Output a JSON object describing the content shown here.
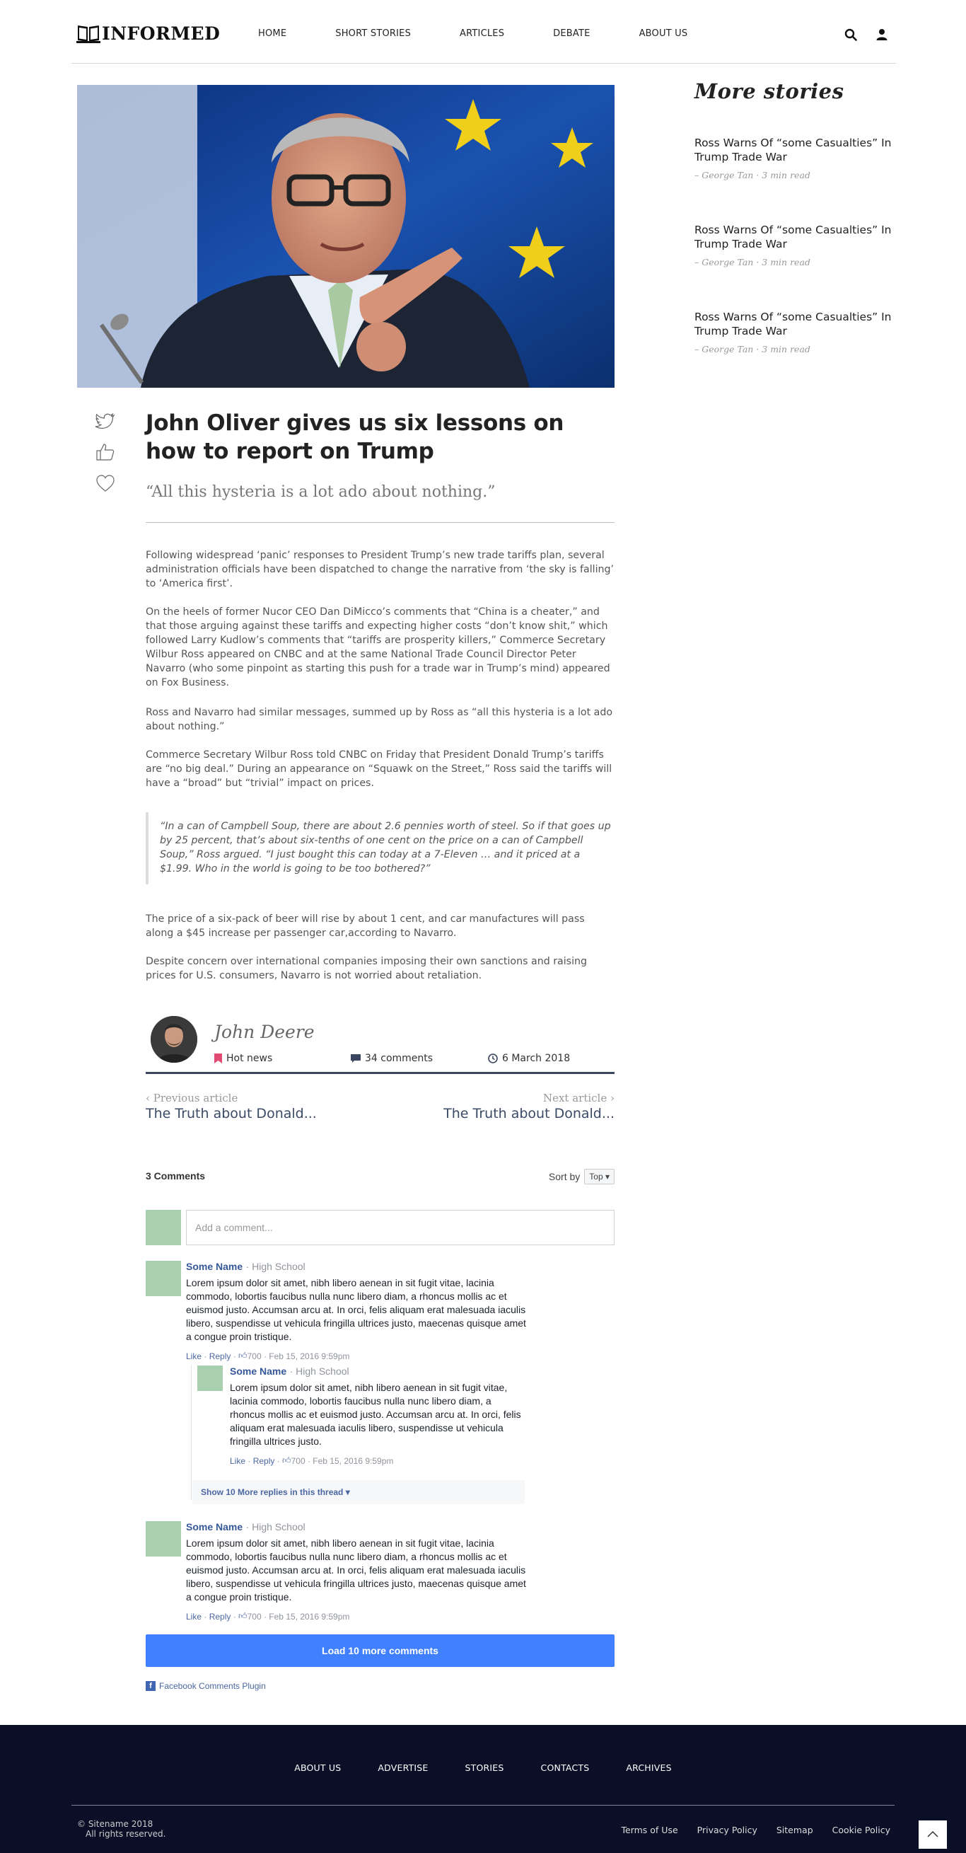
{
  "brand": {
    "name": "INFORMED"
  },
  "nav": {
    "items": [
      "HOME",
      "SHORT STORIES",
      "ARTICLES",
      "DEBATE",
      "ABOUT US"
    ]
  },
  "article": {
    "title": "John Oliver gives us six lessons on how to report on Trump",
    "subtitle": "“All this hysteria is a lot ado about nothing.”",
    "paragraphs": [
      "Following widespread ‘panic’ responses to President Trump’s new trade tariffs plan, several administration officials have been dispatched to change the narrative from ‘the sky is falling’ to ‘America first’.",
      "On the heels of former Nucor CEO Dan DiMicco’s comments that “China is a cheater,” and that those arguing against these tariffs and expecting higher costs “don’t know shit,” which followed Larry Kudlow’s comments that “tariffs are prosperity killers,” Commerce Secretary Wilbur Ross appeared on CNBC and at the same National Trade Council Director Peter Navarro (who some pinpoint as starting this push for a trade war in Trump’s mind) appeared on Fox Business.",
      "Ross and Navarro had similar messages, summed up by Ross as “all this hysteria is a lot ado about nothing.”",
      "Commerce Secretary Wilbur Ross told CNBC on Friday that President Donald Trump’s tariffs are “no big deal.” During an appearance on “Squawk on the Street,” Ross said the tariffs will have a “broad” but “trivial” impact on prices."
    ],
    "quote": "“In a can of Campbell Soup, there are about 2.6 pennies worth of steel. So if that goes up by 25 percent, that’s about six-tenths of one cent on the price on a can of Campbell Soup,” Ross argued. “I just bought this can today at a 7-Eleven … and it priced at a $1.99. Who in the world is going to be too bothered?”",
    "paragraphs_after": [
      "The price of a six-pack of beer will rise by about 1 cent, and car manufactures will pass along a $45 increase per passenger car,according to Navarro.",
      "Despite concern over international companies imposing their own sanctions and raising prices for U.S. consumers, Navarro is not worried about retaliation."
    ],
    "author": "John Deere",
    "category": "Hot news",
    "comments_count": "34 comments",
    "date": "6 March 2018"
  },
  "prevnext": {
    "prev_label": "‹ Previous article",
    "prev_title": "The Truth about Donald...",
    "next_label": "Next article ›",
    "next_title": "The Truth about Donald..."
  },
  "comments": {
    "count_label": "3 Comments",
    "sort_label": "Sort by",
    "sort_value": "Top",
    "placeholder": "Add a comment...",
    "items": [
      {
        "name": "Some Name",
        "school": "· High School",
        "text": "Lorem ipsum dolor sit amet, nibh libero aenean in sit fugit vitae, lacinia commodo, lobortis faucibus nulla nunc libero diam, a rhoncus mollis ac et euismod justo. Accumsan arcu at. In orci, felis aliquam erat malesuada iaculis libero, suspendisse ut vehicula fringilla ultrices justo, maecenas quisque amet a congue proin tristique.",
        "like": "Like",
        "reply": "Reply",
        "likes": "700",
        "time": "Feb 15, 2016 9:59pm"
      },
      {
        "name": "Some Name",
        "school": "· High School",
        "text": "Lorem ipsum dolor sit amet, nibh libero aenean in sit fugit vitae, lacinia commodo, lobortis faucibus nulla nunc libero diam, a rhoncus mollis ac et euismod justo. Accumsan arcu at. In orci, felis aliquam erat malesuada iaculis libero, suspendisse ut vehicula fringilla ultrices justo.",
        "like": "Like",
        "reply": "Reply",
        "likes": "700",
        "time": "Feb 15, 2016 9:59pm"
      },
      {
        "name": "Some Name",
        "school": "· High School",
        "text": "Lorem ipsum dolor sit amet, nibh libero aenean in sit fugit vitae, lacinia commodo, lobortis faucibus nulla nunc libero diam, a rhoncus mollis ac et euismod justo. Accumsan arcu at. In orci, felis aliquam erat malesuada iaculis libero, suspendisse ut vehicula fringilla ultrices justo, maecenas quisque amet a congue proin tristique.",
        "like": "Like",
        "reply": "Reply",
        "likes": "700",
        "time": "Feb 15, 2016 9:59pm"
      }
    ],
    "more_replies": "Show 10 More replies in this thread",
    "load_more": "Load 10 more comments",
    "plugin": "Facebook Comments Plugin"
  },
  "sidebar": {
    "title": "More stories",
    "stories": [
      {
        "title": "Ross Warns Of “some Casualties” In Trump Trade War",
        "meta": "– George Tan · 3 min read"
      },
      {
        "title": "Ross Warns Of “some Casualties” In Trump Trade War",
        "meta": "– George Tan · 3 min read"
      },
      {
        "title": "Ross Warns Of “some Casualties” In Trump Trade War",
        "meta": "– George Tan · 3 min read"
      }
    ]
  },
  "footer": {
    "nav": [
      "ABOUT US",
      "ADVERTISE",
      "STORIES",
      "CONTACTS",
      "ARCHIVES"
    ],
    "copyright": "© Sitename 2018",
    "rights": "All rights reserved.",
    "links": [
      "Terms of Use",
      "Privacy Policy",
      "Sitemap",
      "Cookie Policy"
    ]
  },
  "colors": {
    "accent": "#3a4660",
    "footer_bg": "#0a0e26",
    "fb_blue": "#4080ff",
    "bookmark": "#e24a74"
  },
  "icons": [
    "book-icon",
    "search-icon",
    "user-icon",
    "twitter-icon",
    "thumbs-up-icon",
    "heart-icon",
    "bookmark-icon",
    "comment-icon",
    "clock-icon",
    "chevron-up-icon",
    "facebook-icon"
  ]
}
